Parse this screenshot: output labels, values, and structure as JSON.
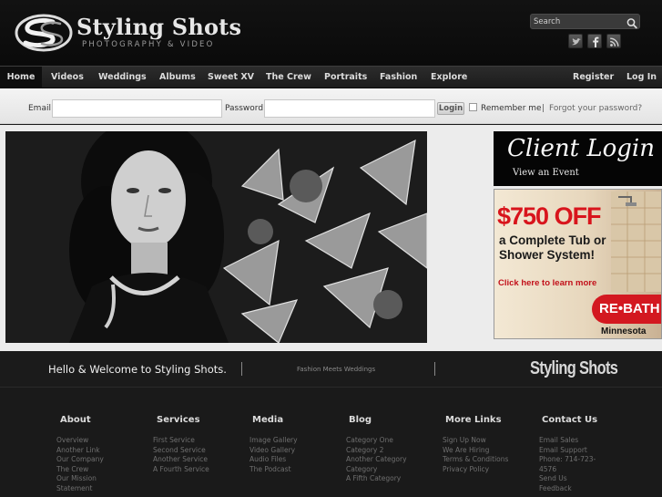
{
  "brand": {
    "title": "Styling Shots",
    "subtitle": "PHOTOGRAPHY & VIDEO"
  },
  "search": {
    "placeholder": "Search"
  },
  "social": [
    "twitter-icon",
    "facebook-icon",
    "rss-icon"
  ],
  "nav": {
    "left": [
      "Home",
      "Videos",
      "Weddings",
      "Albums",
      "Sweet XV",
      "The Crew",
      "Portraits",
      "Fashion",
      "Explore"
    ],
    "right": [
      "Register",
      "Log In"
    ],
    "active": "Home"
  },
  "login": {
    "email_label": "Email:",
    "password_label": "Password:",
    "button": "Login",
    "remember": "Remember me",
    "separator": "|",
    "forgot": "Forgot your password?"
  },
  "client_login": {
    "title": "Client Login",
    "subtitle": "View an Event"
  },
  "ad": {
    "price": "$750 OFF",
    "line1": "a Complete Tub or",
    "line2": "Shower System!",
    "cta": "Click here to learn more",
    "brand": "RE•BATH",
    "region": "Minnesota"
  },
  "welcome": {
    "text": "Hello & Welcome to Styling Shots.",
    "tagline": "Fashion Meets Weddings",
    "brand": "Styling Shots"
  },
  "footer": [
    {
      "heading": "About",
      "links": [
        "Overview",
        "Another Link",
        "Our Company",
        "The Crew",
        "Our Mission Statement"
      ]
    },
    {
      "heading": "Services",
      "links": [
        "First Service",
        "Second Service",
        "Another Service",
        "A Fourth Service"
      ]
    },
    {
      "heading": "Media",
      "links": [
        "Image Gallery",
        "Video Gallery",
        "Audio Files",
        "The Podcast"
      ]
    },
    {
      "heading": "Blog",
      "links": [
        "Category One",
        "Category 2",
        "Another Category",
        "Category",
        "A Fifth Category"
      ]
    },
    {
      "heading": "More Links",
      "links": [
        "Sign Up Now",
        "We Are Hiring",
        "Terms & Conditions",
        "Privacy Policy"
      ]
    },
    {
      "heading": "Contact Us",
      "links": [
        "Email Sales",
        "Email Support",
        "Phone: 714-723-4576",
        "Send Us Feedback"
      ]
    }
  ],
  "colors": {
    "header_bg": "#0d0d0d",
    "nav_bg": "#242424",
    "login_bar_bg": "#ececec",
    "ad_red": "#d8141c",
    "footer_bg": "#1a1a1a"
  }
}
